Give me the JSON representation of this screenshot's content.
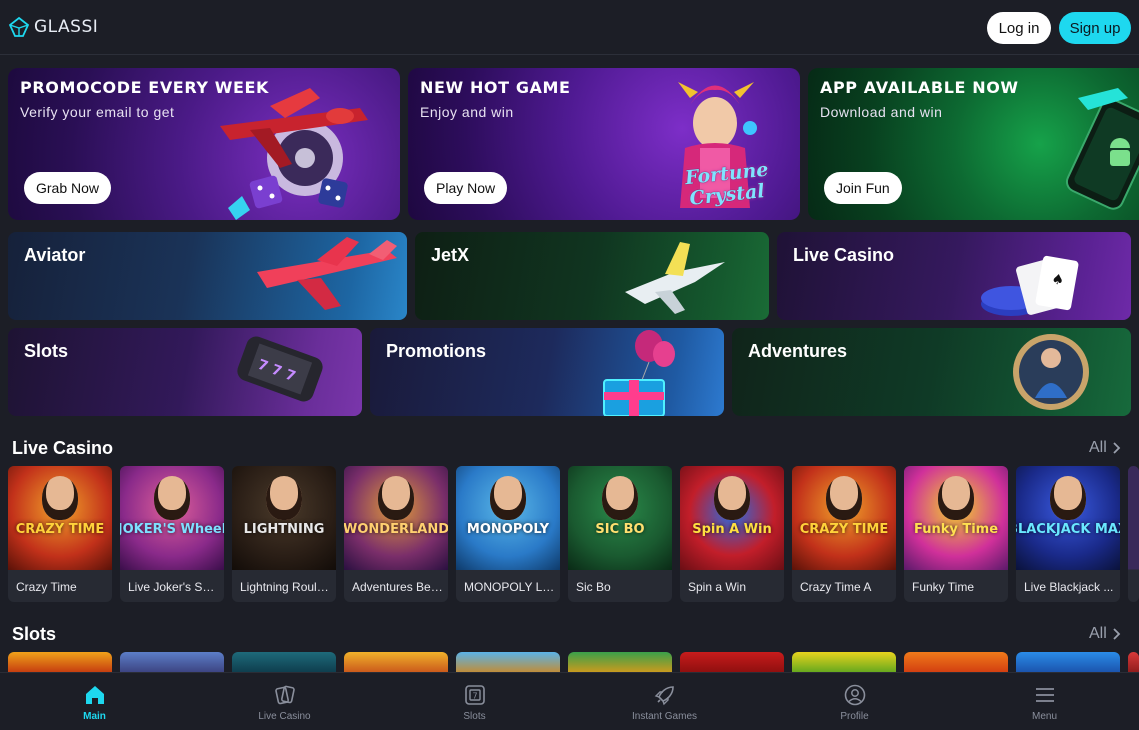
{
  "header": {
    "logo_text": "GLASSI",
    "login_label": "Log in",
    "signup_label": "Sign up"
  },
  "promos": [
    {
      "title": "PROMOCODE EVERY WEEK",
      "subtitle": "Verify your email to get",
      "button": "Grab Now"
    },
    {
      "title": "NEW HOT GAME",
      "subtitle": "Enjoy and win",
      "button": "Play Now",
      "art_text_1": "Fortune",
      "art_text_2": "Crystal"
    },
    {
      "title": "APP AVAILABLE NOW",
      "subtitle": "Download and win",
      "button": "Join Fun"
    }
  ],
  "categories": {
    "row1": [
      "Aviator",
      "JetX",
      "Live Casino"
    ],
    "row2": [
      "Slots",
      "Promotions",
      "Adventures"
    ]
  },
  "live_casino": {
    "title": "Live Casino",
    "all_label": "All",
    "games": [
      {
        "label": "Crazy Time",
        "badge": "CRAZY TIME"
      },
      {
        "label": "Live Joker's Show",
        "badge": "JOKER'S Wheel"
      },
      {
        "label": "Lightning Roule...",
        "badge": "LIGHTNING"
      },
      {
        "label": "Adventures Bey...",
        "badge": "WONDERLAND"
      },
      {
        "label": "MONOPOLY Live",
        "badge": "MONOPOLY"
      },
      {
        "label": "Sic Bo",
        "badge": "SIC BO"
      },
      {
        "label": "Spin a Win",
        "badge": "Spin A Win"
      },
      {
        "label": "Crazy Time A",
        "badge": "CRAZY TIME"
      },
      {
        "label": "Funky Time",
        "badge": "Funky Time"
      },
      {
        "label": "Live Blackjack ...",
        "badge": "BLACKJACK MAX"
      }
    ]
  },
  "slots": {
    "title": "Slots",
    "all_label": "All"
  },
  "bottom_nav": [
    {
      "label": "Main",
      "icon": "home-icon",
      "active": true
    },
    {
      "label": "Live Casino",
      "icon": "cards-icon"
    },
    {
      "label": "Slots",
      "icon": "slot-machine-icon"
    },
    {
      "label": "Instant Games",
      "icon": "rocket-icon"
    },
    {
      "label": "Profile",
      "icon": "user-icon"
    },
    {
      "label": "Menu",
      "icon": "hamburger-menu-icon"
    }
  ],
  "colors": {
    "background": "#1c1e26",
    "accent": "#1ed8ef",
    "card": "#272a33"
  }
}
